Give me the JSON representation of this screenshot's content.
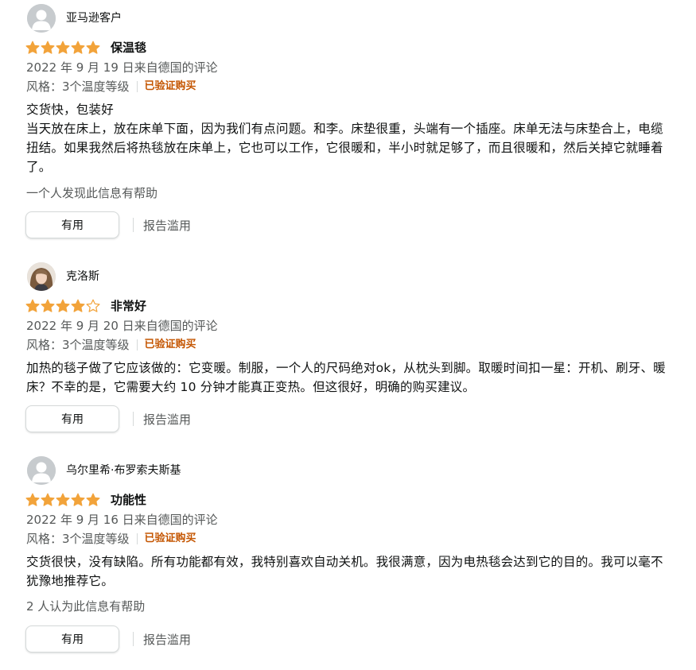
{
  "colors": {
    "star": "#f2a33a",
    "verified": "#c45500",
    "meta_text": "#565959",
    "body_text": "#0f1111"
  },
  "reviews": [
    {
      "author": "亚马逊客户",
      "avatar": "default-avatar-icon",
      "rating": 5,
      "title": "保温毯",
      "date_line": "2022 年 9 月 19 日来自德国的评论",
      "variant": "风格：3个温度等级",
      "verified": "已验证购买",
      "body": [
        "交货快，包装好",
        "当天放在床上，放在床单下面，因为我们有点问题。和李。床垫很重，头端有一个插座。床单无法与床垫合上，电缆扭结。如果我然后将热毯放在床单上，它也可以工作，它很暖和，半小时就足够了，而且很暖和，然后关掉它就睡着了。"
      ],
      "helpful": "一个人发现此信息有帮助",
      "helpful_button": "有用",
      "report": "报告滥用"
    },
    {
      "author": "克洛斯",
      "avatar": "user-photo-avatar",
      "rating": 4,
      "title": "非常好",
      "date_line": "2022 年 9 月 20 日来自德国的评论",
      "variant": "风格：3个温度等级",
      "verified": "已验证购买",
      "body": [
        "加热的毯子做了它应该做的：它变暖。制服，一个人的尺码绝对ok，从枕头到脚。取暖时间扣一星：开机、刷牙、暖床？不幸的是，它需要大约 10 分钟才能真正变热。但这很好，明确的购买建议。"
      ],
      "helpful": "",
      "helpful_button": "有用",
      "report": "报告滥用"
    },
    {
      "author": "乌尔里希·布罗索夫斯基",
      "avatar": "default-avatar-icon",
      "rating": 5,
      "title": "功能性",
      "date_line": "2022 年 9 月 16 日来自德国的评论",
      "variant": "风格：3个温度等级",
      "verified": "已验证购买",
      "body": [
        "交货很快，没有缺陷。所有功能都有效，我特别喜欢自动关机。我很满意，因为电热毯会达到它的目的。我可以毫不犹豫地推荐它。"
      ],
      "helpful": "2 人认为此信息有帮助",
      "helpful_button": "有用",
      "report": "报告滥用"
    }
  ]
}
